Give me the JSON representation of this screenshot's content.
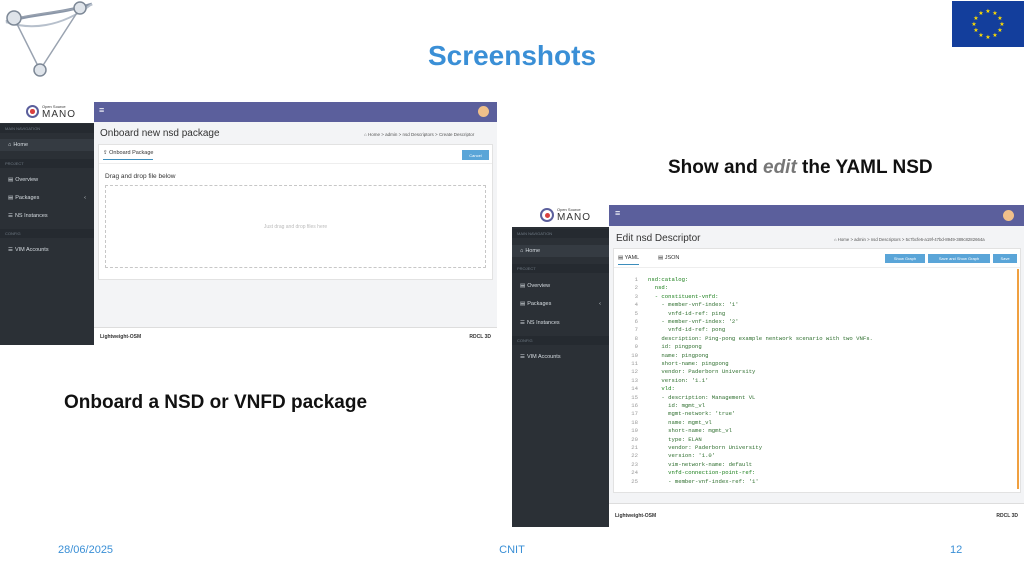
{
  "slide": {
    "title": "Screenshots",
    "caption_left": "Onboard a NSD or VNFD package",
    "caption_right_before": "Show and ",
    "caption_right_em": "edit",
    "caption_right_after": " the YAML NSD",
    "footer_date": "28/06/2025",
    "footer_center": "CNIT",
    "page_number": "12"
  },
  "shot1": {
    "logo_small": "Open Source",
    "logo_big": "MANO",
    "nav_header_1": "MAIN NAVIGATION",
    "home": "Home",
    "nav_header_2": "PROJECT",
    "overview": "Overview",
    "packages": "Packages",
    "ns_instances": "NS Instances",
    "nav_header_3": "CONFIG",
    "vim_accounts": "VIM Accounts",
    "page_title": "Onboard new nsd package",
    "breadcrumb": [
      "Home",
      "admin",
      "nsd Descriptors",
      "Create Descriptor"
    ],
    "tab_label": "Onboard Package",
    "cancel_label": "Cancel",
    "drop_heading": "Drag and drop file below",
    "drop_hint": "Just drag and drop files here",
    "footer_left": "Lightweight-OSM",
    "footer_right": "RDCL 3D"
  },
  "shot2": {
    "logo_small": "Open Source",
    "logo_big": "MANO",
    "nav_header_1": "MAIN NAVIGATION",
    "home": "Home",
    "nav_header_2": "PROJECT",
    "overview": "Overview",
    "packages": "Packages",
    "ns_instances": "NS Instances",
    "nav_header_3": "CONFIG",
    "vim_accounts": "VIM Accounts",
    "page_title": "Edit nsd Descriptor",
    "breadcrumb": [
      "Home",
      "admin",
      "nsd Descriptors",
      "5c7bcfe6-a19f-47bd-8949-389c8282664a"
    ],
    "tab_yaml": "YAML",
    "tab_json": "JSON",
    "btn_show_graph": "Show Graph",
    "btn_save_show_graph": "Save and Show Graph",
    "btn_save": "Save",
    "footer_left": "Lightweight-OSM",
    "footer_right": "RDCL 3D",
    "code_lines": [
      "nsd:catalog:",
      "  nsd:",
      "  - constituent-vnfd:",
      "    - member-vnf-index: '1'",
      "      vnfd-id-ref: ping",
      "    - member-vnf-index: '2'",
      "      vnfd-id-ref: pong",
      "    description: Ping-pong example nentwork scenario with two VNFs.",
      "    id: pingpong",
      "    name: pingpong",
      "    short-name: pingpong",
      "    vendor: Paderborn University",
      "    version: '1.1'",
      "    vld:",
      "    - description: Management VL",
      "      id: mgmt_vl",
      "      mgmt-network: 'true'",
      "      name: mgmt_vl",
      "      short-name: mgmt_vl",
      "      type: ELAN",
      "      vendor: Paderborn University",
      "      version: '1.0'",
      "      vim-network-name: default",
      "      vnfd-connection-point-ref:",
      "      - member-vnf-index-ref: '1'"
    ]
  },
  "colors": {
    "title_blue": "#3a8fd6",
    "topbar": "#5b5f9c",
    "sidebar": "#2b3036",
    "button_blue": "#5aa5d8",
    "eu_blue": "#133e9c",
    "eu_star": "#ffdd00"
  },
  "icons": [
    "triangle-logo-icon",
    "eu-flag-icon",
    "home-icon",
    "file-icon",
    "list-icon",
    "upload-icon",
    "user-avatar-icon",
    "hamburger-icon"
  ]
}
